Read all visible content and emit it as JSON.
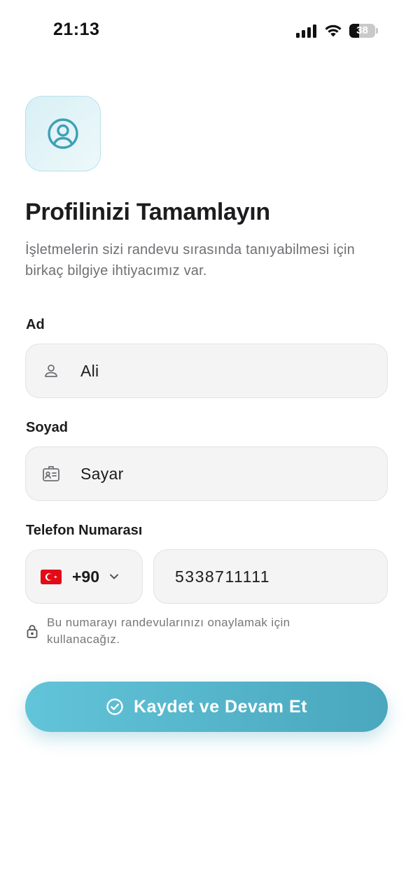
{
  "status_bar": {
    "time": "21:13",
    "battery_percent": "38",
    "battery_level": 0.38
  },
  "header": {
    "avatar_icon": "user-circle-icon",
    "title": "Profilinizi Tamamlayın",
    "subtitle": "İşletmelerin sizi randevu sırasında tanıyabilmesi için birkaç bilgiye ihtiyacımız var."
  },
  "form": {
    "first_name": {
      "label": "Ad",
      "value": "Ali",
      "icon": "user-icon"
    },
    "last_name": {
      "label": "Soyad",
      "value": "Sayar",
      "icon": "id-card-icon"
    },
    "phone": {
      "label": "Telefon Numarası",
      "country_flag": "turkey-flag-icon",
      "country_code": "+90",
      "value": "5338711111",
      "hint": "Bu numarayı randevularınızı onaylamak için kullanacağız.",
      "hint_icon": "lock-icon"
    }
  },
  "actions": {
    "submit_label": "Kaydet ve Devam Et",
    "submit_icon": "check-circle-icon"
  },
  "colors": {
    "accent": "#4aa7bd",
    "accent_light": "#62c4d9",
    "field_bg": "#f4f4f5"
  }
}
